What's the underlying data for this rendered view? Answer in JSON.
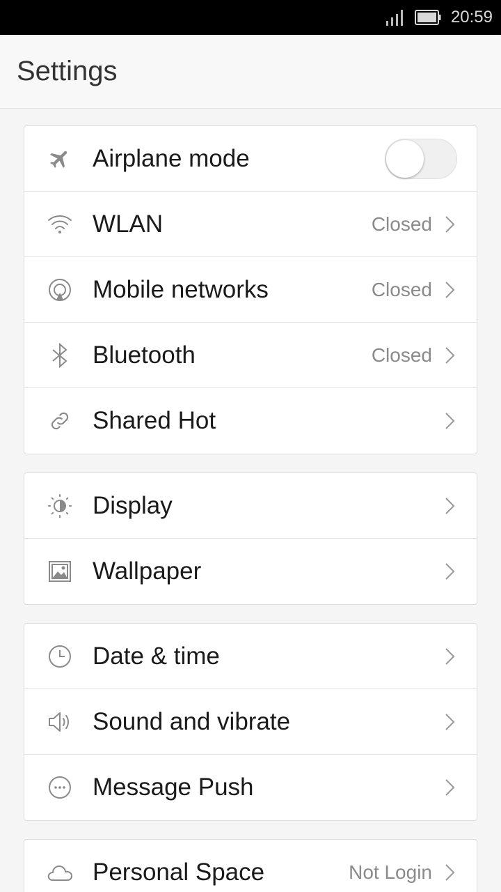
{
  "status_bar": {
    "time": "20:59",
    "icons": [
      "signal-icon",
      "battery-icon"
    ]
  },
  "header": {
    "title": "Settings"
  },
  "groups": [
    {
      "items": [
        {
          "label": "Airplane mode",
          "icon": "airplane-icon",
          "control": "toggle",
          "toggle_on": false
        },
        {
          "label": "WLAN",
          "icon": "wifi-icon",
          "value": "Closed"
        },
        {
          "label": "Mobile networks",
          "icon": "mobile-network-icon",
          "value": "Closed"
        },
        {
          "label": "Bluetooth",
          "icon": "bluetooth-icon",
          "value": "Closed"
        },
        {
          "label": "Shared Hot",
          "icon": "link-icon"
        }
      ]
    },
    {
      "items": [
        {
          "label": "Display",
          "icon": "brightness-icon"
        },
        {
          "label": "Wallpaper",
          "icon": "image-icon"
        }
      ]
    },
    {
      "items": [
        {
          "label": "Date & time",
          "icon": "clock-icon"
        },
        {
          "label": "Sound and vibrate",
          "icon": "speaker-icon"
        },
        {
          "label": "Message Push",
          "icon": "message-icon"
        }
      ]
    },
    {
      "items": [
        {
          "label": "Personal Space",
          "icon": "cloud-icon",
          "value": "Not Login"
        }
      ]
    }
  ],
  "colors": {
    "background": "#f5f5f5",
    "card": "#ffffff",
    "text": "#1a1a1a",
    "secondary_text": "#8a8a8a",
    "icon": "#8a8a8a"
  }
}
